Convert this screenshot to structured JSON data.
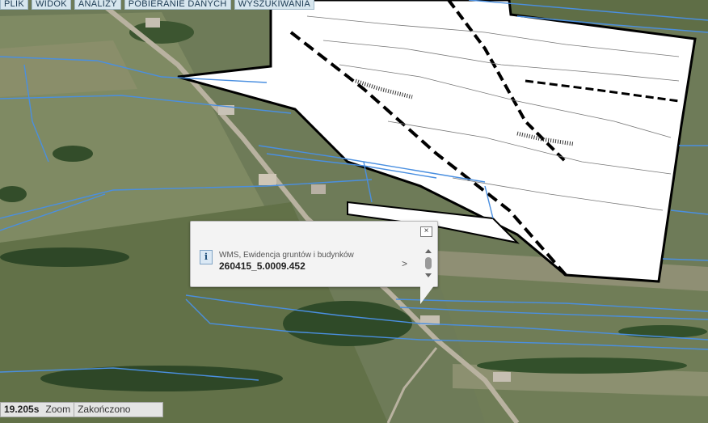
{
  "menu": {
    "items": [
      {
        "label": "PLIK"
      },
      {
        "label": "WIDOK"
      },
      {
        "label": "ANALIZY"
      },
      {
        "label": "POBIERANIE DANYCH"
      },
      {
        "label": "WYSZUKIWANIA"
      }
    ]
  },
  "popup": {
    "layer_name": "WMS, Ewidencja gruntów i budynków",
    "parcel_id": "260415_5.0009.452",
    "close_symbol": "×",
    "next_symbol": ">",
    "info_symbol": "i"
  },
  "status": {
    "time": "19.205s",
    "action": "Zoom",
    "state": "Zakończono"
  },
  "colors": {
    "parcel_lines": "#4a8fe0",
    "map_overlay": "#ffffff",
    "boundary": "#000000"
  },
  "icons": [
    "close-icon",
    "info-icon",
    "chevron-right-icon",
    "scroll-up-icon",
    "scroll-down-icon"
  ]
}
